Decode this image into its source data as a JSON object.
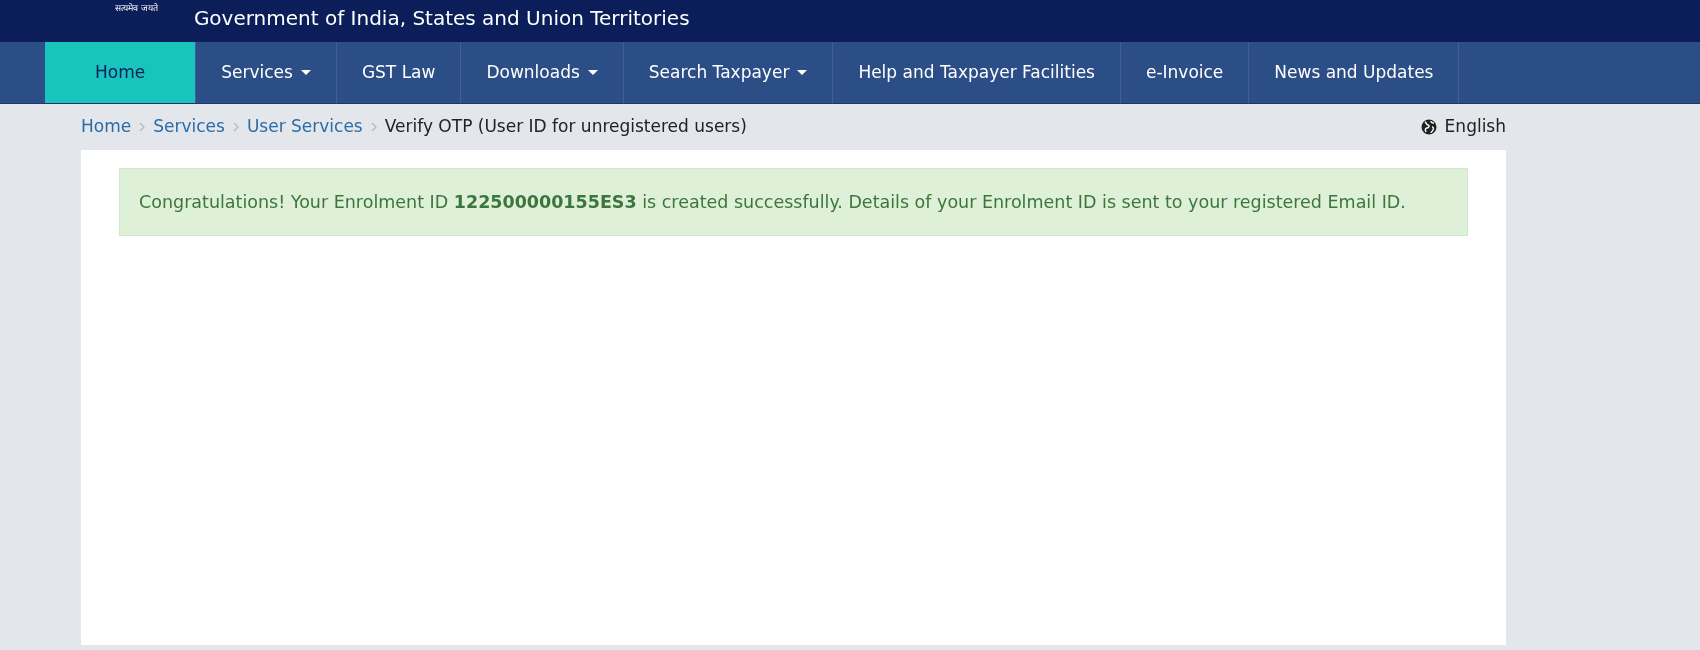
{
  "header": {
    "motto": "सत्यमेव जयते",
    "title": "Government of India, States and Union Territories"
  },
  "nav": [
    {
      "label": "Home",
      "selected": true,
      "dropdown": false
    },
    {
      "label": "Services",
      "selected": false,
      "dropdown": true
    },
    {
      "label": "GST Law",
      "selected": false,
      "dropdown": false
    },
    {
      "label": "Downloads",
      "selected": false,
      "dropdown": true
    },
    {
      "label": "Search Taxpayer",
      "selected": false,
      "dropdown": true
    },
    {
      "label": "Help and Taxpayer Facilities",
      "selected": false,
      "dropdown": false
    },
    {
      "label": "e-Invoice",
      "selected": false,
      "dropdown": false
    },
    {
      "label": "News and Updates",
      "selected": false,
      "dropdown": false
    }
  ],
  "breadcrumb": [
    {
      "label": "Home",
      "kind": "link"
    },
    {
      "label": "Services",
      "kind": "link"
    },
    {
      "label": "User Services",
      "kind": "link"
    },
    {
      "label": "Verify OTP (User ID for unregistered users)",
      "kind": "current"
    }
  ],
  "language": "English",
  "alert": "Congratulations! Your Enrolment ID **122500000155ES3** is created successfully. Details of your Enrolment ID is sent to your registered Email ID."
}
